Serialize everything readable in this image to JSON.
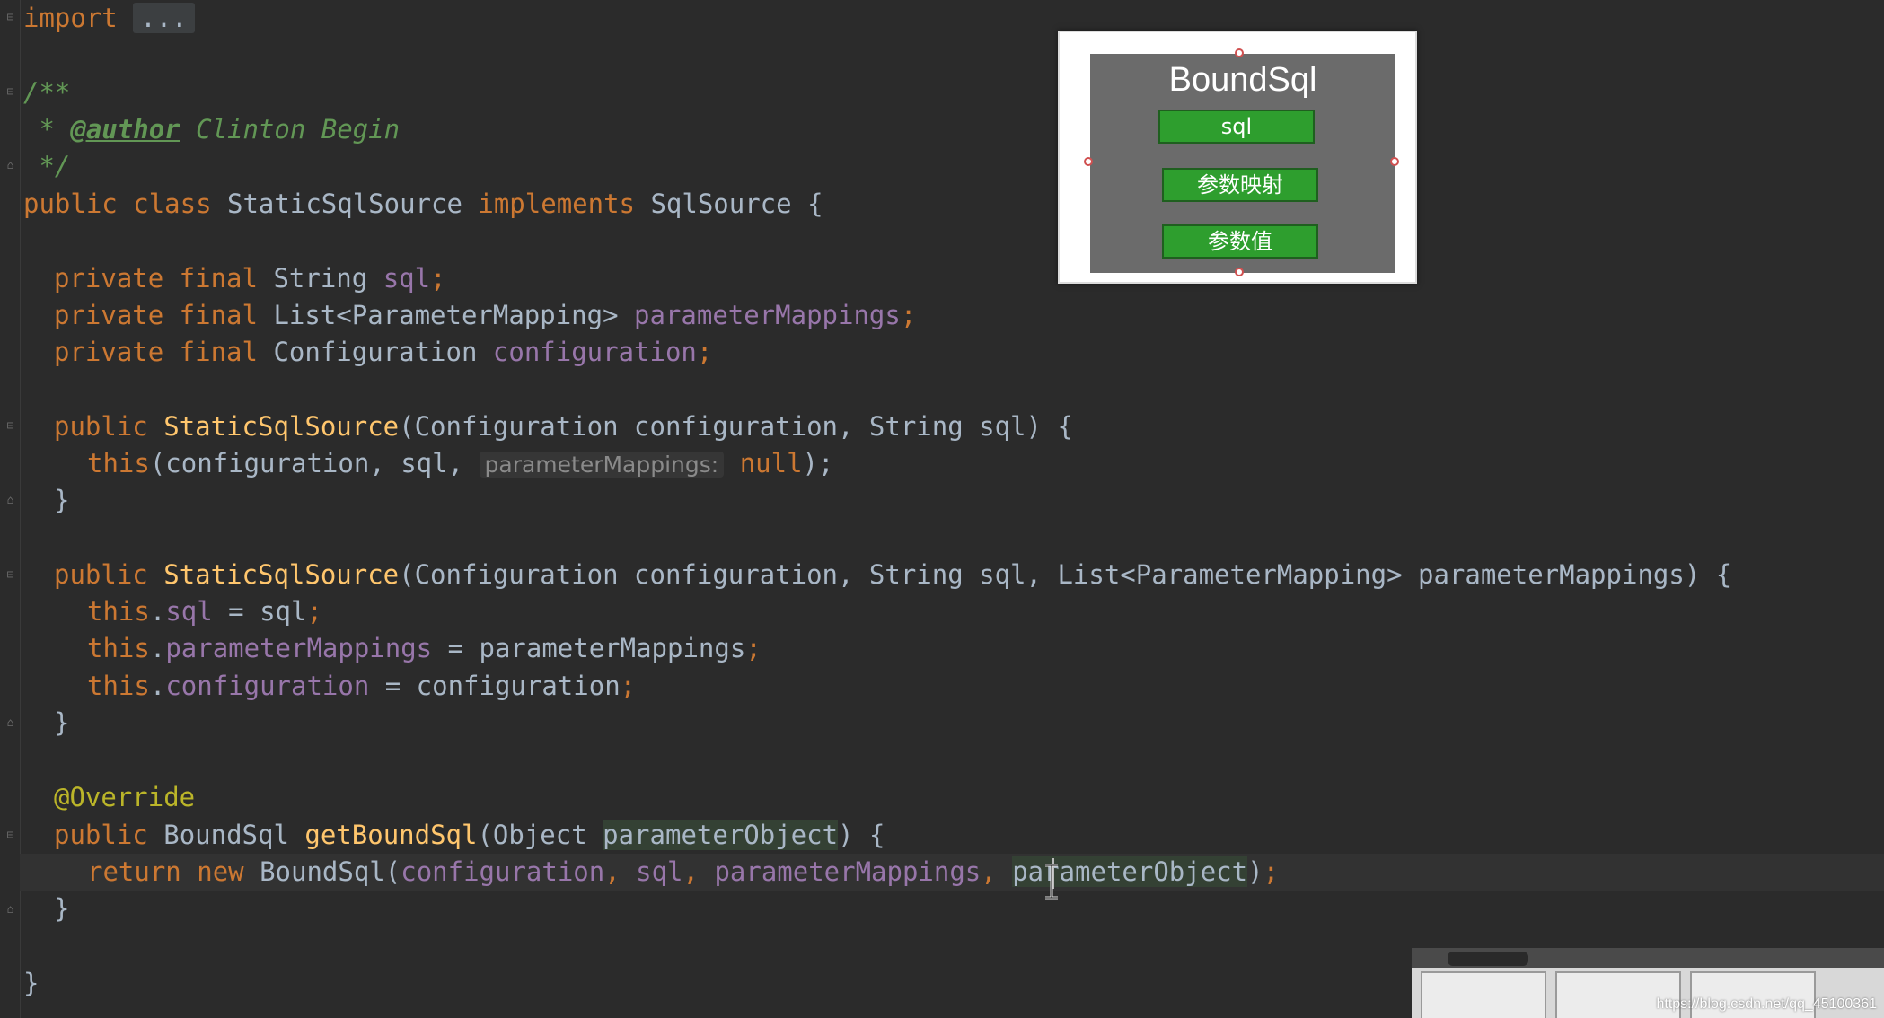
{
  "editor": {
    "import_kw": "import",
    "import_fold": "...",
    "javadoc_open": "/**",
    "javadoc_star": " * ",
    "author_tag": "@author",
    "author_name": " Clinton Begin",
    "javadoc_close": " */",
    "class_decl": {
      "kw_public": "public",
      "kw_class": "class",
      "name": "StaticSqlSource",
      "kw_implements": "implements",
      "iface": "SqlSource",
      "brace": "{"
    },
    "fields": [
      {
        "mods": "private final",
        "type": "String",
        "name": "sql",
        "end": ";"
      },
      {
        "mods": "private final",
        "type": "List<ParameterMapping>",
        "name": "parameterMappings",
        "end": ";"
      },
      {
        "mods": "private final",
        "type": "Configuration",
        "name": "configuration",
        "end": ";"
      }
    ],
    "ctor1": {
      "kw": "public",
      "name": "StaticSqlSource",
      "params": "(Configuration configuration, String sql) {",
      "this_kw": "this",
      "call_open": "(configuration, sql, ",
      "hint": "parameterMappings:",
      "null_kw": "null",
      "call_close": ");",
      "close": "}"
    },
    "ctor2": {
      "kw": "public",
      "name": "StaticSqlSource",
      "params": "(Configuration configuration, String sql, List<ParameterMapping> parameterMappings) {",
      "assigns": [
        {
          "this_kw": "this",
          "dot": ".",
          "field": "sql",
          "rhs": " = sql",
          "end": ";"
        },
        {
          "this_kw": "this",
          "dot": ".",
          "field": "parameterMappings",
          "rhs": " = parameterMappings",
          "end": ";"
        },
        {
          "this_kw": "this",
          "dot": ".",
          "field": "configuration",
          "rhs": " = configuration",
          "end": ";"
        }
      ],
      "close": "}"
    },
    "method": {
      "annotation": "@Override",
      "kw": "public",
      "ret": "BoundSql",
      "name": "getBoundSql",
      "param_open": "(Object ",
      "param": "parameterObject",
      "param_close": ") {",
      "return_kw": "return",
      "new_kw": "new",
      "ctor_call": "BoundSql(",
      "arg1": "configuration",
      "arg2": "sql",
      "arg3": "parameterMappings",
      "arg4": "parameterObject",
      "sep": ", ",
      "call_close": ")",
      "end": ";",
      "close": "}"
    },
    "class_close": "}"
  },
  "overlay_diagram": {
    "title": "BoundSql",
    "fields": [
      "sql",
      "参数映射",
      "参数值"
    ]
  },
  "webcam": {
    "watermark": "https://blog.csdn.net/qq_45100361"
  }
}
